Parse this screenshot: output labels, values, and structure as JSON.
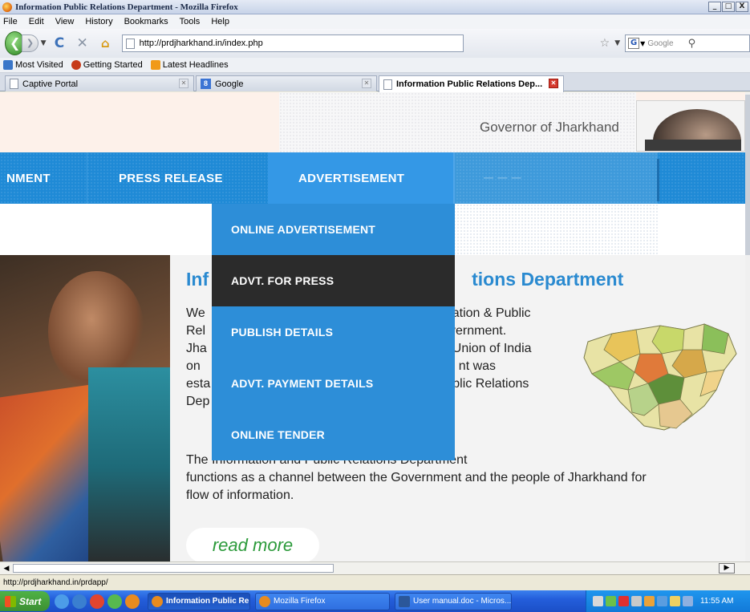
{
  "window": {
    "title": "Information Public Relations Department - Mozilla Firefox",
    "controls": [
      "_",
      "□",
      "X"
    ]
  },
  "menubar": [
    "File",
    "Edit",
    "View",
    "History",
    "Bookmarks",
    "Tools",
    "Help"
  ],
  "navbar": {
    "url": "http://prdjharkhand.in/index.php",
    "search_placeholder": "Google",
    "search_engine_letter": "G"
  },
  "bookmarks": [
    "Most Visited",
    "Getting Started",
    "Latest Headlines"
  ],
  "tabs": [
    {
      "label": "Captive Portal",
      "icon": "page-icon"
    },
    {
      "label": "Google",
      "icon": "google-icon"
    },
    {
      "label": "Information Public Relations Dep...",
      "icon": "page-icon",
      "active": true
    }
  ],
  "page": {
    "header": {
      "governor_text": "Governor of Jharkhand"
    },
    "nav": {
      "items": [
        "NMENT",
        "PRESS RELEASE",
        "ADVERTISEMENT"
      ],
      "active": "ADVERTISEMENT"
    },
    "dropdown": {
      "items": [
        "ONLINE ADVERTISEMENT",
        "ADVT. FOR PRESS",
        "PUBLISH DETAILS",
        "ADVT. PAYMENT DETAILS",
        "ONLINE TENDER"
      ],
      "highlighted": "ADVT. FOR PRESS"
    },
    "content": {
      "title_left": "Inf",
      "title_right": "tions Department",
      "lines_left": [
        "We",
        "Rel",
        "Jha",
        "on",
        "esta",
        "Dep"
      ],
      "lines_right": [
        "ation & Public",
        "vernment.",
        "Union of India",
        "nt was",
        "blic Relations",
        ""
      ],
      "para2_line1": "The Information and Public Relations Department",
      "para2_line2": "functions as a channel between the Government and the people of Jharkhand for",
      "para2_line3": "flow of information.",
      "read_more": "read more"
    }
  },
  "statusbar": "http://prdjharkhand.in/prdapp/",
  "taskbar": {
    "start": "Start",
    "buttons": [
      "Information Public Re...",
      "Mozilla Firefox",
      "User manual.doc - Micros..."
    ],
    "clock": "11:55 AM"
  },
  "colors": {
    "nav_blue": "#1f8ad6",
    "dropdown_blue": "#2d8ed8",
    "dropdown_hover": "#2b2b2b",
    "title_blue": "#2a8ad0",
    "read_more_green": "#2b9a3a"
  }
}
